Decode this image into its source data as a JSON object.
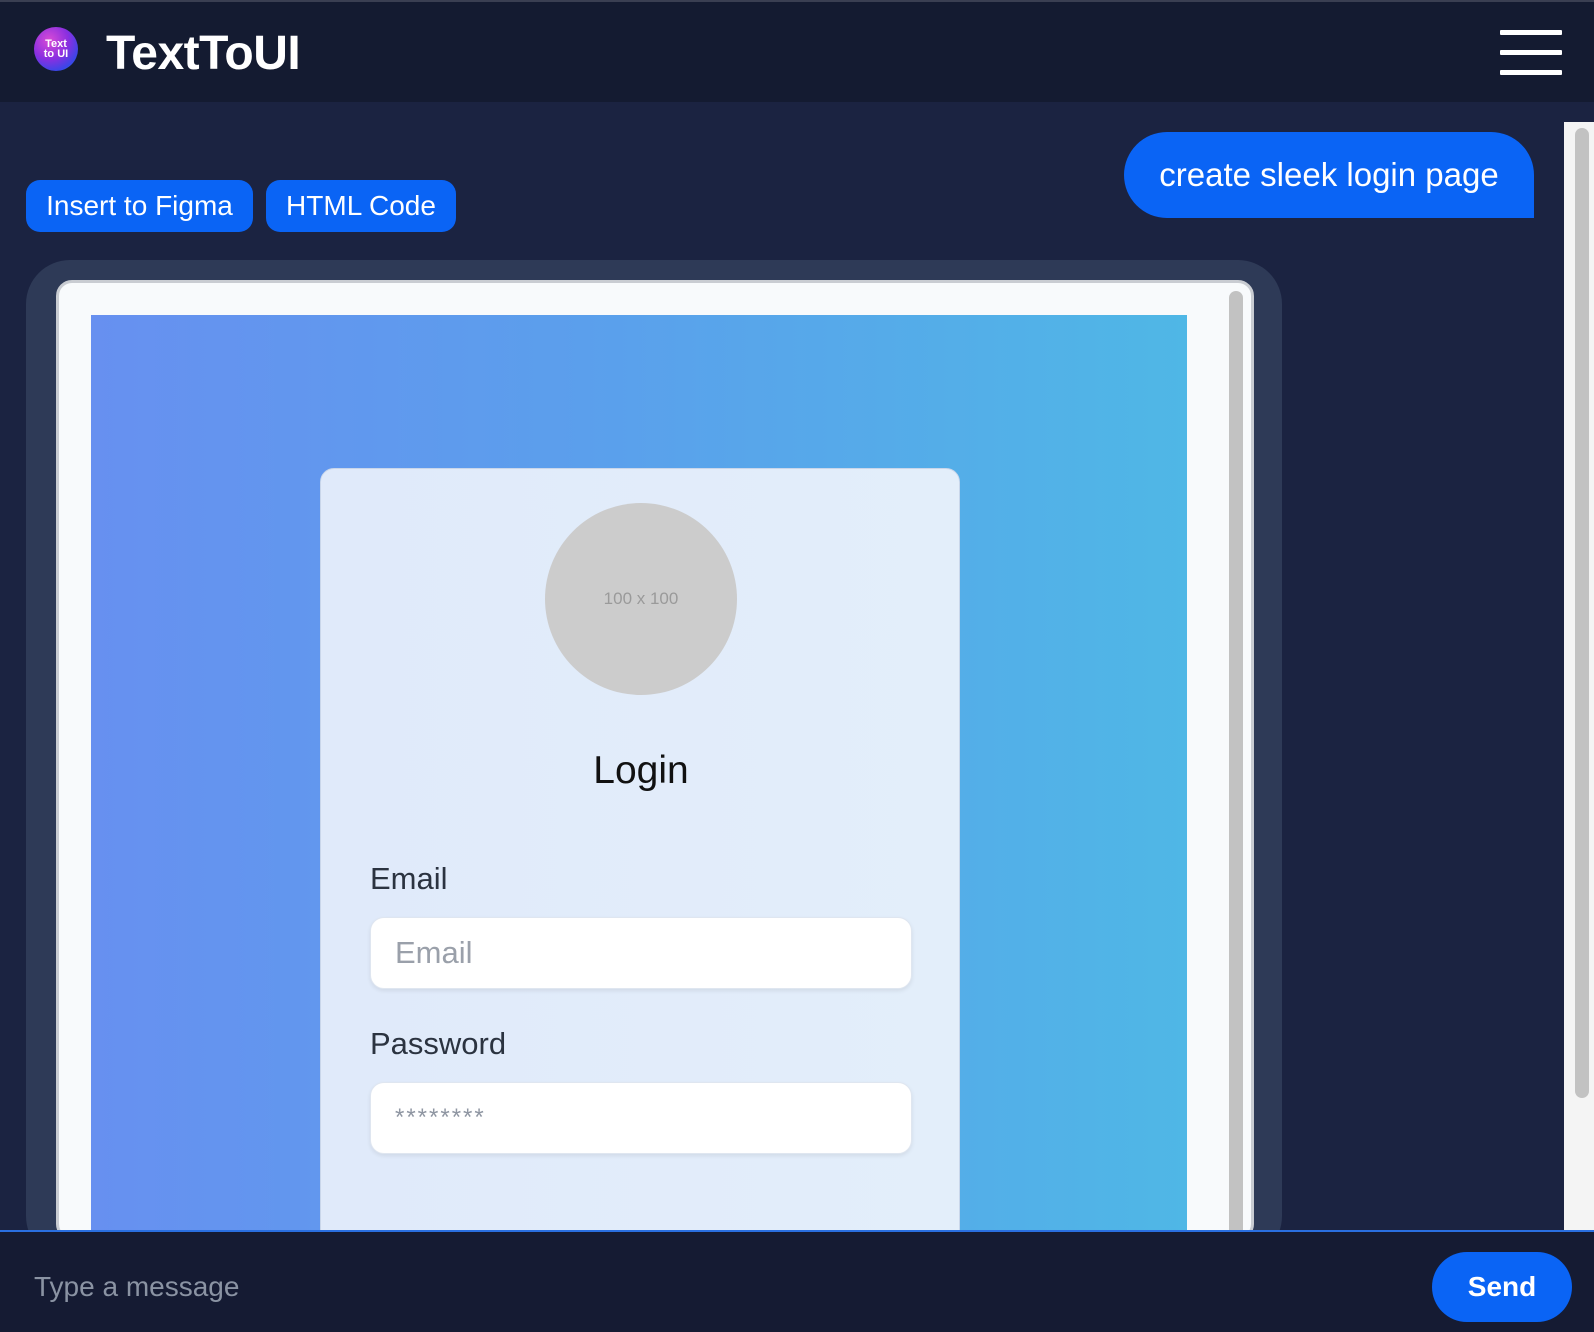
{
  "app": {
    "brand": "TextToUI",
    "logo_text_line1": "Text",
    "logo_text_line2": "to UI"
  },
  "header": {
    "menu_icon": "hamburger-menu-icon"
  },
  "chat": {
    "user_message": "create sleek login page",
    "actions": {
      "insert_figma": "Insert to Figma",
      "html_code": "HTML Code"
    }
  },
  "preview": {
    "avatar_placeholder": "100 x 100",
    "title": "Login",
    "email_label": "Email",
    "email_placeholder": "Email",
    "password_label": "Password",
    "password_placeholder": "********"
  },
  "composer": {
    "placeholder": "Type a message",
    "send_label": "Send"
  },
  "colors": {
    "accent": "#0a64f5",
    "header_bg": "#141b31",
    "chat_bg": "#1b2341",
    "preview_gradient_start": "#6790f0",
    "preview_gradient_end": "#4fb7e6"
  }
}
